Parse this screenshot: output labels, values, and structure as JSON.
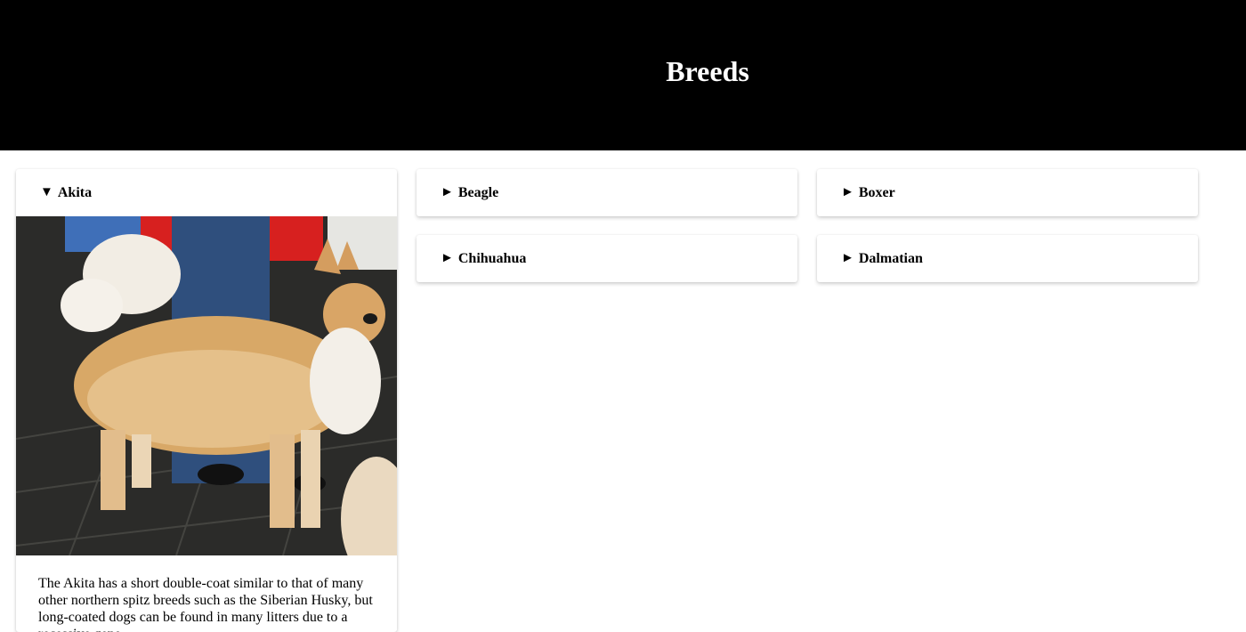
{
  "header": {
    "title": "Breeds"
  },
  "breeds": [
    {
      "name": "Akita",
      "marker": "▼",
      "expanded": true,
      "description": "The Akita has a short double-coat similar to that of many other northern spitz breeds such as the Siberian Husky, but long-coated dogs can be found in many litters due to a recessive gene."
    },
    {
      "name": "Beagle",
      "marker": "►",
      "expanded": false
    },
    {
      "name": "Boxer",
      "marker": "►",
      "expanded": false
    },
    {
      "name": "Chihuahua",
      "marker": "►",
      "expanded": false
    },
    {
      "name": "Dalmatian",
      "marker": "►",
      "expanded": false
    }
  ],
  "colors": {
    "header_bg": "#000000",
    "header_text": "#ffffff",
    "card_bg": "#ffffff"
  }
}
